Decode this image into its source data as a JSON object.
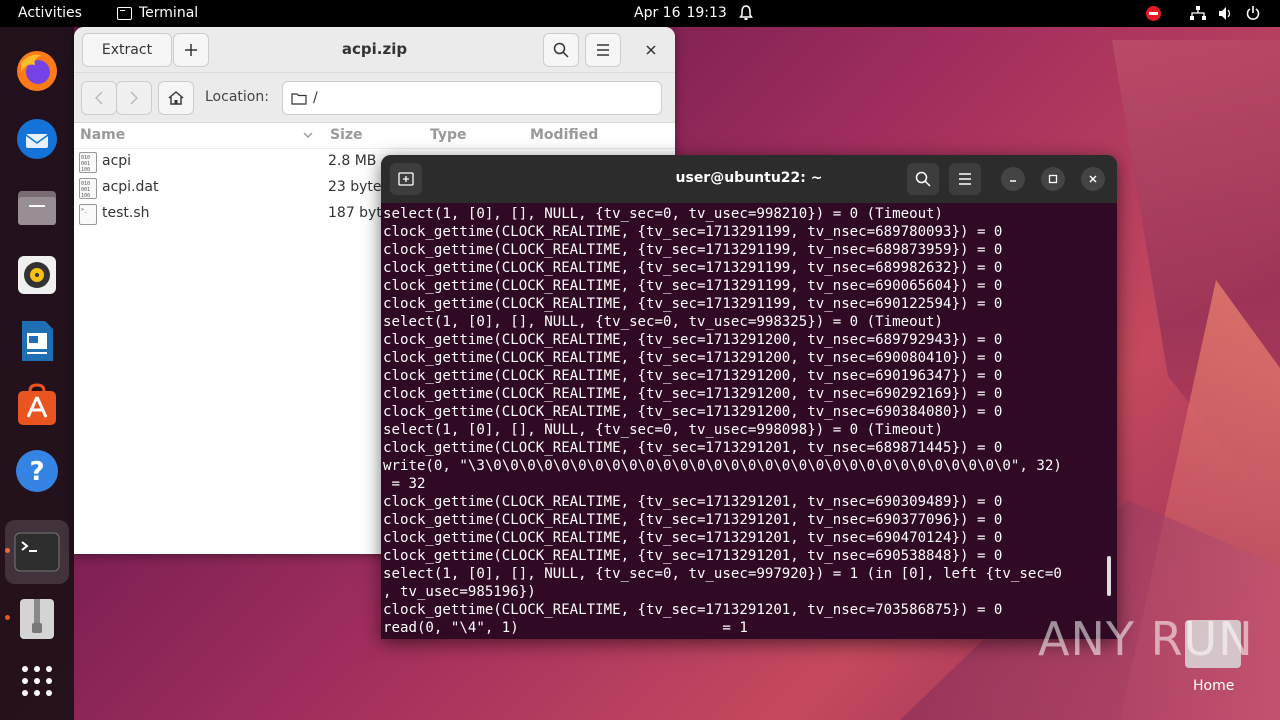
{
  "topbar": {
    "activities": "Activities",
    "app_name": "Terminal",
    "date": "Apr 16",
    "time": "19:13"
  },
  "dock": {
    "items": [
      "firefox-icon",
      "thunderbird-icon",
      "files-icon",
      "rhythmbox-icon",
      "libreoffice-writer-icon",
      "app-center-icon",
      "help-icon",
      "terminal-icon",
      "archive-manager-icon",
      "show-apps-icon"
    ]
  },
  "archive": {
    "title": "acpi.zip",
    "extract_label": "Extract",
    "location_label": "Location:",
    "location_value": "/",
    "columns": {
      "name": "Name",
      "size": "Size",
      "type": "Type",
      "modified": "Modified"
    },
    "files": [
      {
        "name": "acpi",
        "size": "2.8 MB"
      },
      {
        "name": "acpi.dat",
        "size": "23 byte"
      },
      {
        "name": "test.sh",
        "size": "187 byt"
      }
    ]
  },
  "terminal": {
    "title": "user@ubuntu22: ~",
    "lines": [
      "select(1, [0], [], NULL, {tv_sec=0, tv_usec=998210}) = 0 (Timeout)",
      "clock_gettime(CLOCK_REALTIME, {tv_sec=1713291199, tv_nsec=689780093}) = 0",
      "clock_gettime(CLOCK_REALTIME, {tv_sec=1713291199, tv_nsec=689873959}) = 0",
      "clock_gettime(CLOCK_REALTIME, {tv_sec=1713291199, tv_nsec=689982632}) = 0",
      "clock_gettime(CLOCK_REALTIME, {tv_sec=1713291199, tv_nsec=690065604}) = 0",
      "clock_gettime(CLOCK_REALTIME, {tv_sec=1713291199, tv_nsec=690122594}) = 0",
      "select(1, [0], [], NULL, {tv_sec=0, tv_usec=998325}) = 0 (Timeout)",
      "clock_gettime(CLOCK_REALTIME, {tv_sec=1713291200, tv_nsec=689792943}) = 0",
      "clock_gettime(CLOCK_REALTIME, {tv_sec=1713291200, tv_nsec=690080410}) = 0",
      "clock_gettime(CLOCK_REALTIME, {tv_sec=1713291200, tv_nsec=690196347}) = 0",
      "clock_gettime(CLOCK_REALTIME, {tv_sec=1713291200, tv_nsec=690292169}) = 0",
      "clock_gettime(CLOCK_REALTIME, {tv_sec=1713291200, tv_nsec=690384080}) = 0",
      "select(1, [0], [], NULL, {tv_sec=0, tv_usec=998098}) = 0 (Timeout)",
      "clock_gettime(CLOCK_REALTIME, {tv_sec=1713291201, tv_nsec=689871445}) = 0",
      "write(0, \"\\3\\0\\0\\0\\0\\0\\0\\0\\0\\0\\0\\0\\0\\0\\0\\0\\0\\0\\0\\0\\0\\0\\0\\0\\0\\0\\0\\0\\0\\0\\0\\0\", 32)",
      " = 32",
      "clock_gettime(CLOCK_REALTIME, {tv_sec=1713291201, tv_nsec=690309489}) = 0",
      "clock_gettime(CLOCK_REALTIME, {tv_sec=1713291201, tv_nsec=690377096}) = 0",
      "clock_gettime(CLOCK_REALTIME, {tv_sec=1713291201, tv_nsec=690470124}) = 0",
      "clock_gettime(CLOCK_REALTIME, {tv_sec=1713291201, tv_nsec=690538848}) = 0",
      "select(1, [0], [], NULL, {tv_sec=0, tv_usec=997920}) = 1 (in [0], left {tv_sec=0",
      ", tv_usec=985196})",
      "clock_gettime(CLOCK_REALTIME, {tv_sec=1713291201, tv_nsec=703586875}) = 0",
      "read(0, \"\\4\", 1)                        = 1"
    ]
  },
  "watermark": {
    "text": "ANY RUN",
    "home_label": "Home"
  }
}
